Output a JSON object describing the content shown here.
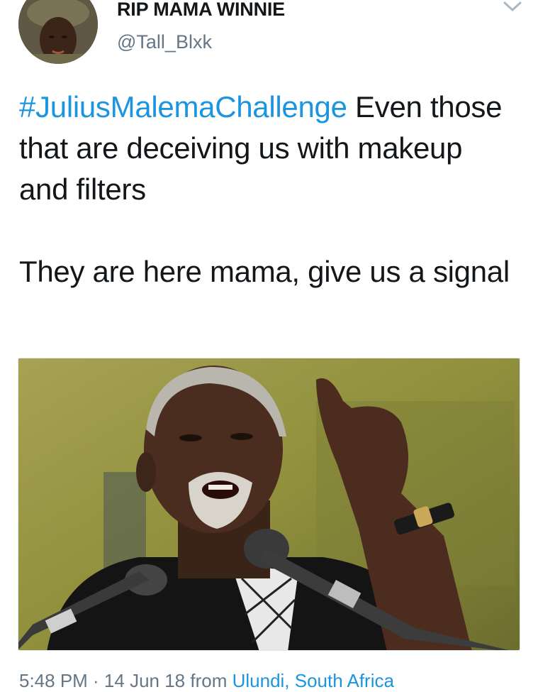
{
  "author": {
    "display_name": "RIP MAMA WINNIE",
    "handle": "@Tall_Blxk"
  },
  "tweet": {
    "hashtag": "#JuliusMalemaChallenge",
    "text_line1_rest": " Even those that are deceiving us with makeup and filters",
    "text_line2": "They are here mama, give us a signal"
  },
  "meta": {
    "partial_text": "5:48 PM · 14 Jun 18 from ",
    "source": "Ulundi, South Africa"
  },
  "icons": {
    "menu": "chevron-down-icon"
  },
  "colors": {
    "hashtag": "#1b95e0",
    "handle": "#657786"
  }
}
